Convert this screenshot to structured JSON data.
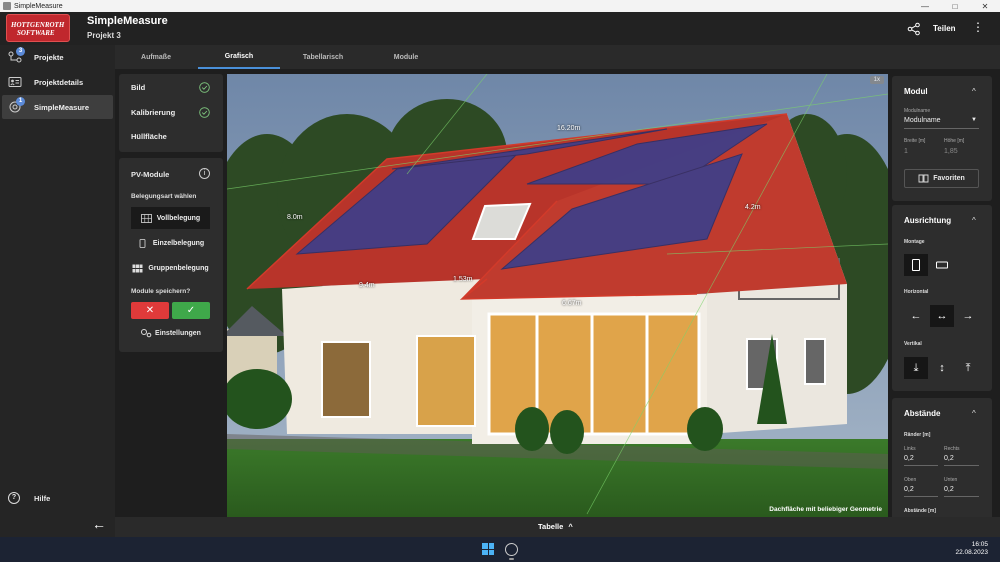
{
  "window": {
    "title": "SimpleMeasure",
    "controls": [
      "—",
      "□",
      "✕"
    ]
  },
  "header": {
    "logo_line1": "HOTTGENROTH",
    "logo_line2": "SOFTWARE",
    "app_title": "SimpleMeasure",
    "project": "Projekt 3",
    "share_label": "Teilen"
  },
  "sidebar": {
    "items": [
      {
        "label": "Projekte",
        "badge": "3"
      },
      {
        "label": "Projektdetails"
      },
      {
        "label": "SimpleMeasure",
        "badge": "1"
      }
    ],
    "help_label": "Hilfe",
    "help_glyph": "?",
    "back_glyph": "←"
  },
  "tabs": [
    "Aufmaße",
    "Grafisch",
    "Tabellarisch",
    "Module"
  ],
  "left_panel": {
    "steps": [
      "Bild",
      "Kalibrierung",
      "Hüllfläche"
    ],
    "pv_title": "PV-Module",
    "info_glyph": "i",
    "belegungsart_label": "Belegungsart wählen",
    "options": [
      "Vollbelegung",
      "Einzelbelegung",
      "Gruppenbelegung"
    ],
    "save_label": "Module speichern?",
    "cancel_glyph": "✕",
    "confirm_glyph": "✓",
    "settings_label": "Einstellungen"
  },
  "photo": {
    "zoom": "1x",
    "caption": "Dachfläche mit beliebiger Geometrie",
    "measurements": [
      "16.20m",
      "8.0m",
      "9.4m",
      "1.53m",
      "6.67m",
      "4.2m"
    ]
  },
  "right_panel": {
    "modul": {
      "title": "Modul",
      "chevron": "^",
      "modulname_label": "Modulname",
      "modulname_value": "Modulname",
      "breite_label": "Breite [m]",
      "breite_value": "1",
      "hoehe_label": "Höhe [m]",
      "hoehe_value": "1,85",
      "favoriten_label": "Favoriten"
    },
    "ausrichtung": {
      "title": "Ausrichtung",
      "chevron": "^",
      "montage_label": "Montage",
      "horizontal_label": "Horizontal",
      "horizontal_glyphs": [
        "←",
        "↔",
        "→"
      ],
      "vertikal_label": "Vertikal",
      "vertikal_glyphs": [
        "⤓",
        "↕",
        "⤒"
      ]
    },
    "abstaende": {
      "title": "Abstände",
      "chevron": "^",
      "raender_label": "Ränder [m]",
      "links_label": "Links",
      "links_value": "0,2",
      "rechts_label": "Rechts",
      "rechts_value": "0,2",
      "oben_label": "Oben",
      "oben_value": "0,2",
      "unten_label": "Unten",
      "unten_value": "0,2",
      "abstaende_label": "Abstände [m]"
    }
  },
  "bottom": {
    "table_label": "Tabelle",
    "chevron": "^"
  },
  "taskbar": {
    "time": "16:05",
    "date": "22.08.2023"
  },
  "colors": {
    "accent_blue": "#4a90d9",
    "logo_red": "#c0272d",
    "cancel_red": "#e03a3a",
    "confirm_green": "#3fa84a",
    "roof_red": "#b8342a",
    "panel_blue": "#3b3f8c"
  }
}
